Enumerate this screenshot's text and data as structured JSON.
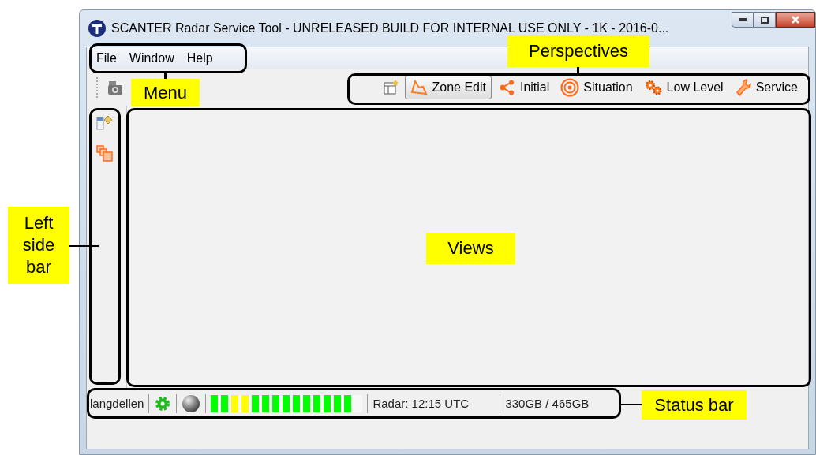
{
  "window": {
    "title": "SCANTER Radar Service Tool - UNRELEASED BUILD FOR INTERNAL USE ONLY - 1K - 2016-0..."
  },
  "menu": [
    "File",
    "Window",
    "Help"
  ],
  "perspectives": [
    {
      "label": "Zone Edit",
      "selected": true,
      "kind": "zone"
    },
    {
      "label": "Initial",
      "selected": false,
      "kind": "share"
    },
    {
      "label": "Situation",
      "selected": false,
      "kind": "target"
    },
    {
      "label": "Low Level",
      "selected": false,
      "kind": "gears"
    },
    {
      "label": "Service",
      "selected": false,
      "kind": "wrench"
    }
  ],
  "status_bar": {
    "user": "langdellen",
    "segments": [
      {
        "color": "#00ff00"
      },
      {
        "color": "#00ff00"
      },
      {
        "color": "#ffff00"
      },
      {
        "color": "#ffff00"
      },
      {
        "color": "#00ff00"
      },
      {
        "color": "#00ff00"
      },
      {
        "color": "#00ff00"
      },
      {
        "color": "#00ff00"
      },
      {
        "color": "#00ff00"
      },
      {
        "color": "#00ff00"
      },
      {
        "color": "#00ff00"
      },
      {
        "color": "#00ff00"
      },
      {
        "color": "#00ff00"
      },
      {
        "color": "#00ff00"
      }
    ],
    "radar_time": "Radar: 12:15 UTC",
    "disk": "330GB / 465GB"
  },
  "annotations": [
    {
      "label": "Menu"
    },
    {
      "label": "Perspectives"
    },
    {
      "label": "Left side bar"
    },
    {
      "label": "Views"
    },
    {
      "label": "Status bar"
    }
  ]
}
